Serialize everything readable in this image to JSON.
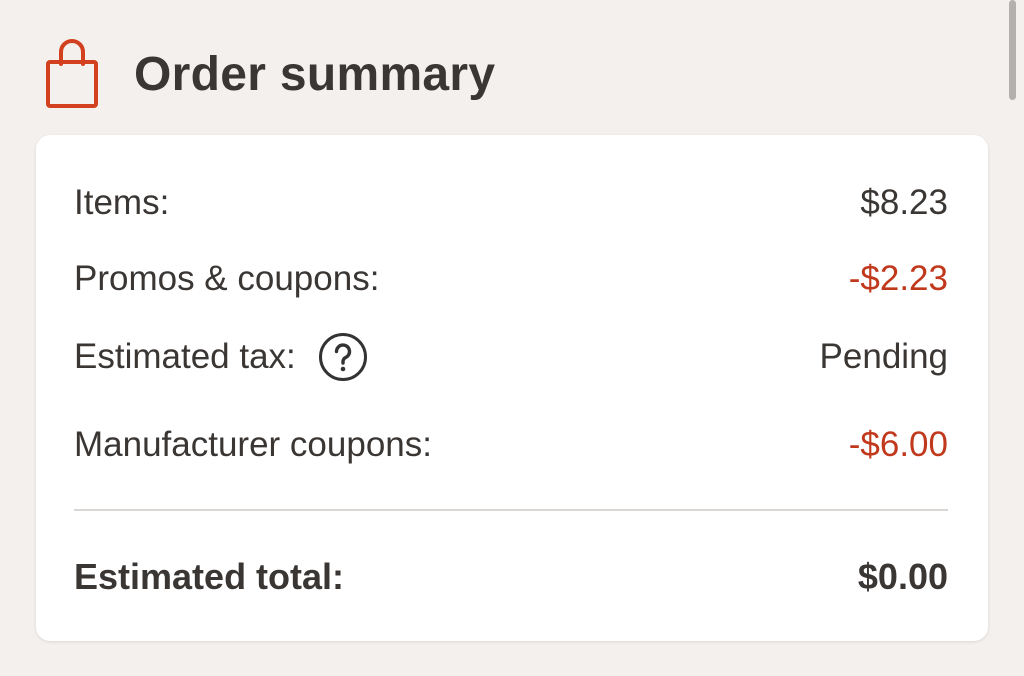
{
  "header": {
    "title": "Order summary",
    "icon": "shopping-bag-icon",
    "icon_color": "#d2401f"
  },
  "summary": {
    "items_label": "Items:",
    "items_value": "$8.23",
    "promos_label": "Promos & coupons:",
    "promos_value": "-$2.23",
    "tax_label": "Estimated tax:",
    "tax_value": "Pending",
    "tax_help_icon": "question-circle-icon",
    "manufacturer_label": "Manufacturer coupons:",
    "manufacturer_value": "-$6.00",
    "total_label": "Estimated total:",
    "total_value": "$0.00"
  },
  "colors": {
    "background": "#f3f0ed",
    "card": "#ffffff",
    "discount": "#c1391c",
    "text": "#3a3634"
  }
}
